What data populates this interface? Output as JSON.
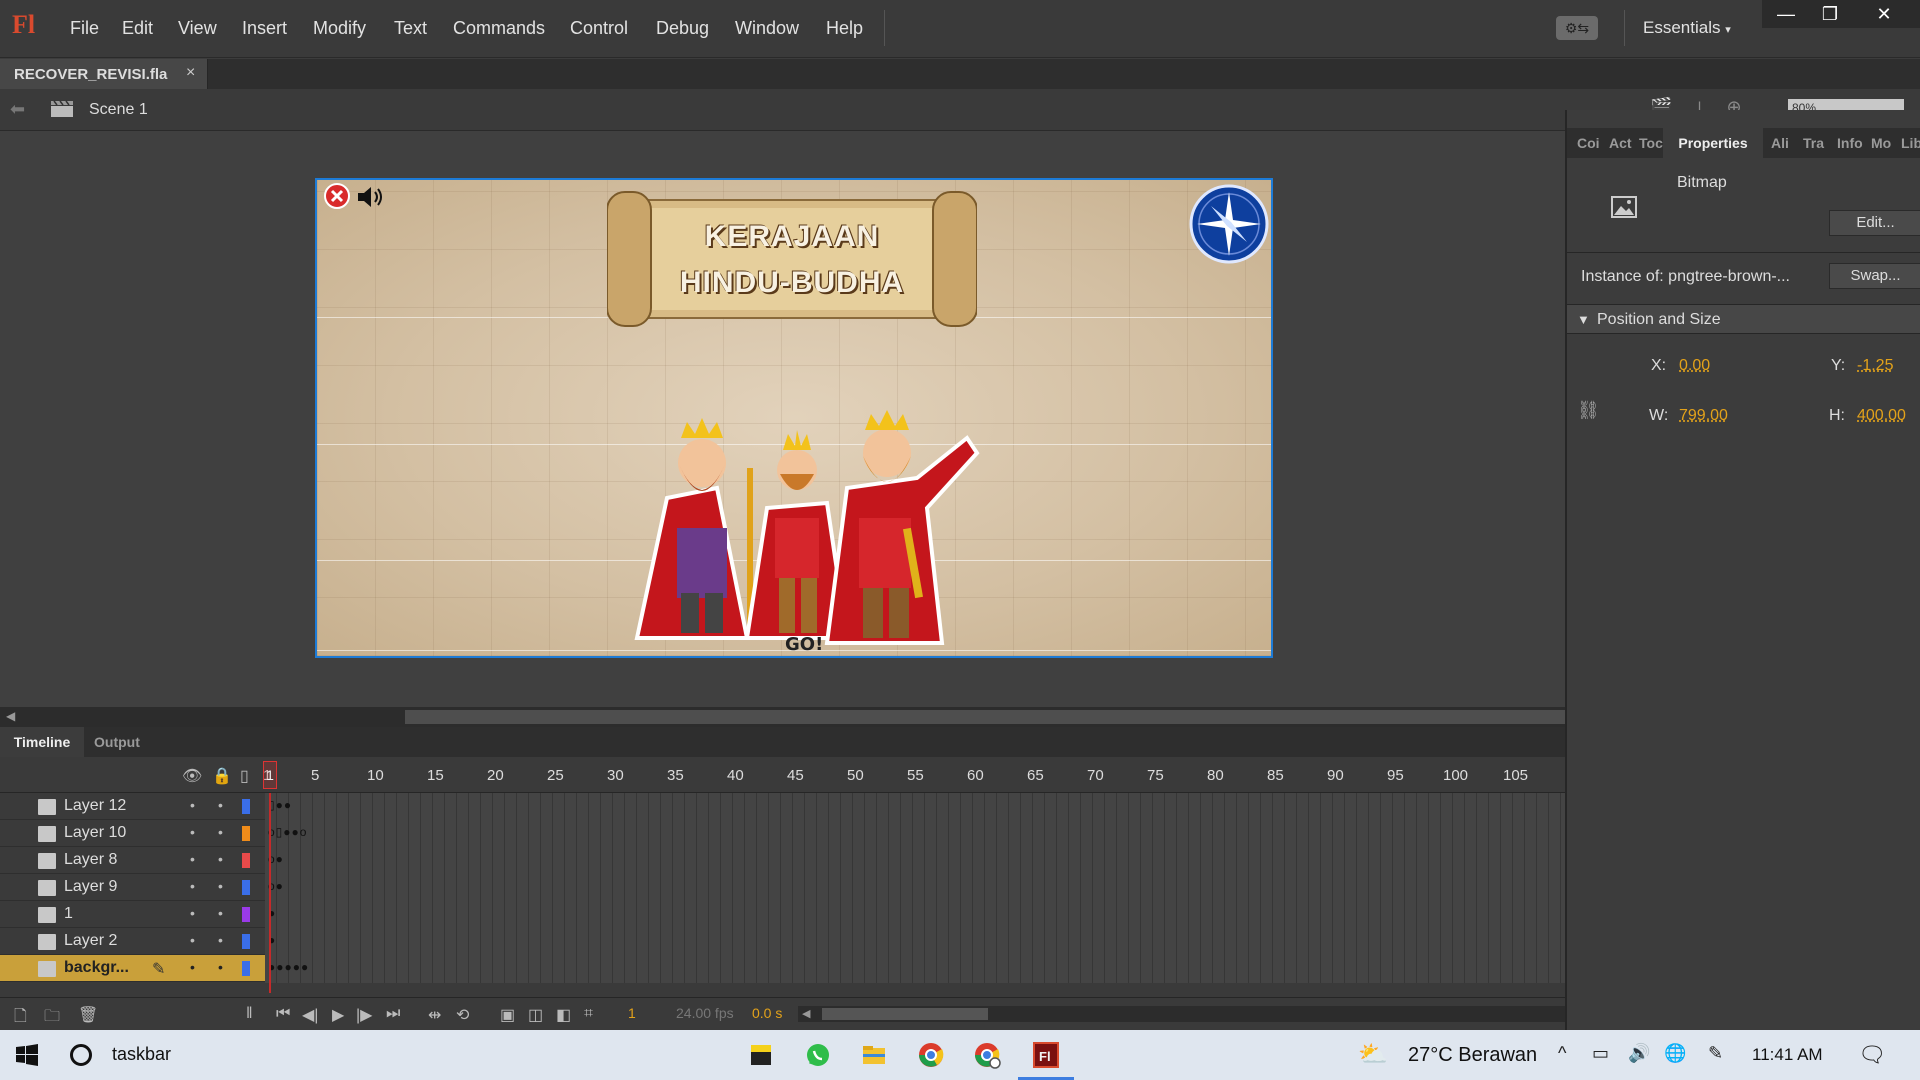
{
  "app": {
    "logo": "Fl",
    "menu": [
      "File",
      "Edit",
      "View",
      "Insert",
      "Modify",
      "Text",
      "Commands",
      "Control",
      "Debug",
      "Window",
      "Help"
    ],
    "workspace": "Essentials",
    "win_min": "—",
    "win_restore": "❐",
    "win_close": "✕"
  },
  "document": {
    "tab_name": "RECOVER_REVISI.fla",
    "tab_close": "×",
    "scene": "Scene 1",
    "zoom": "80%"
  },
  "stage": {
    "title_line1": "KERAJAAN",
    "title_line2": "HINDU-BUDHA",
    "go_text": "GO!"
  },
  "properties": {
    "tabs": [
      "Coi",
      "Act",
      "Toc",
      "Properties",
      "Ali",
      "Tra",
      "Info",
      "Mo",
      "Lib"
    ],
    "active_tab": "Properties",
    "type": "Bitmap",
    "edit_button": "Edit...",
    "instance_label": "Instance of:  pngtree-brown-...",
    "swap_button": "Swap...",
    "section": "Position and Size",
    "x_label": "X:",
    "x_value": "0.00",
    "y_label": "Y:",
    "y_value": "-1.25",
    "w_label": "W:",
    "w_value": "799.00",
    "h_label": "H:",
    "h_value": "400.00"
  },
  "timeline": {
    "tab_timeline": "Timeline",
    "tab_output": "Output",
    "frame_numbers": [
      "1",
      "5",
      "10",
      "15",
      "20",
      "25",
      "30",
      "35",
      "40",
      "45",
      "50",
      "55",
      "60",
      "65",
      "70",
      "75",
      "80",
      "85",
      "90",
      "95",
      "100",
      "105"
    ],
    "layers": [
      {
        "name": "Layer 12",
        "color": "#3a6ee8",
        "keys": "▯●●"
      },
      {
        "name": "Layer 10",
        "color": "#f08c1a",
        "keys": "o▯●●o"
      },
      {
        "name": "Layer 8",
        "color": "#e84a4a",
        "keys": "o●"
      },
      {
        "name": "Layer 9",
        "color": "#3a6ee8",
        "keys": "o●"
      },
      {
        "name": "1",
        "color": "#9a3ae8",
        "keys": "●"
      },
      {
        "name": "Layer 2",
        "color": "#3a6ee8",
        "keys": "●"
      },
      {
        "name": "backgr...",
        "color": "#3a6ee8",
        "keys": "●●●●●"
      }
    ],
    "current_frame": "1",
    "fps": "24.00 fps",
    "time": "0.0 s"
  },
  "taskbar": {
    "search": "taskbar",
    "weather": "27°C  Berawan",
    "clock": "11:41 AM"
  },
  "colors": {
    "accent_orange": "#e3a21a",
    "stage_border": "#1d7bd6",
    "selected_layer": "#c9a03a"
  }
}
